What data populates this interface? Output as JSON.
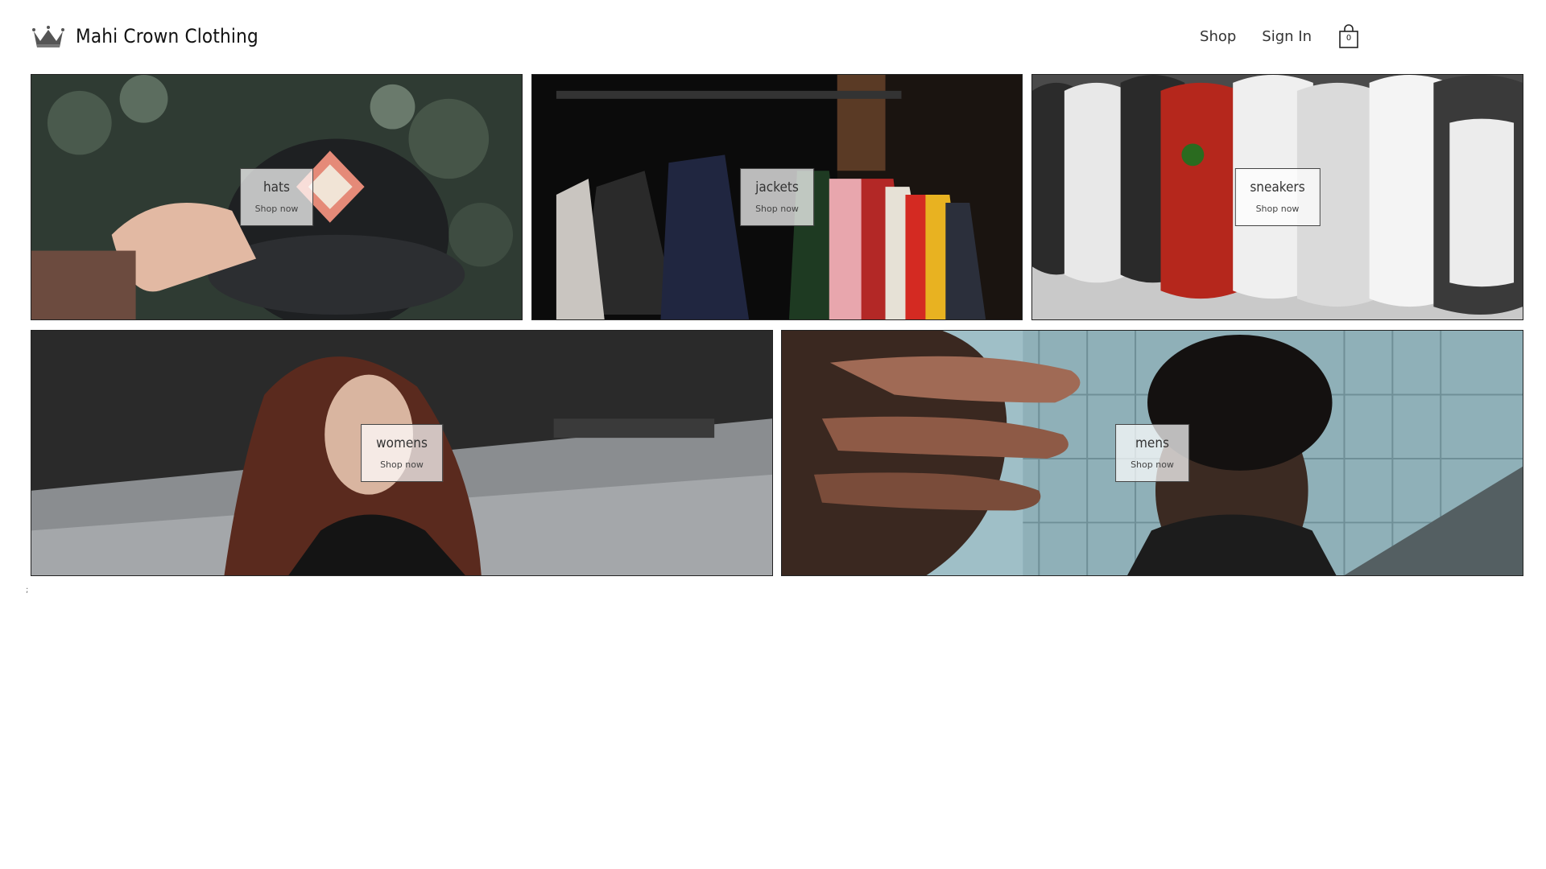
{
  "header": {
    "brand": "Mahi Crown Clothing",
    "logo_icon": "crown-icon",
    "nav": {
      "shop": "Shop",
      "sign_in": "Sign In"
    },
    "cart": {
      "icon": "shopping-bag-icon",
      "count": "0"
    }
  },
  "directory": {
    "shop_label": "Shop now",
    "categories": [
      {
        "title": "hats"
      },
      {
        "title": "jackets"
      },
      {
        "title": "sneakers"
      },
      {
        "title": "womens"
      },
      {
        "title": "mens"
      }
    ]
  },
  "footer_mark": ";",
  "colors": {
    "text": "#222222",
    "border": "#222222",
    "overlay": "#ffffff"
  }
}
